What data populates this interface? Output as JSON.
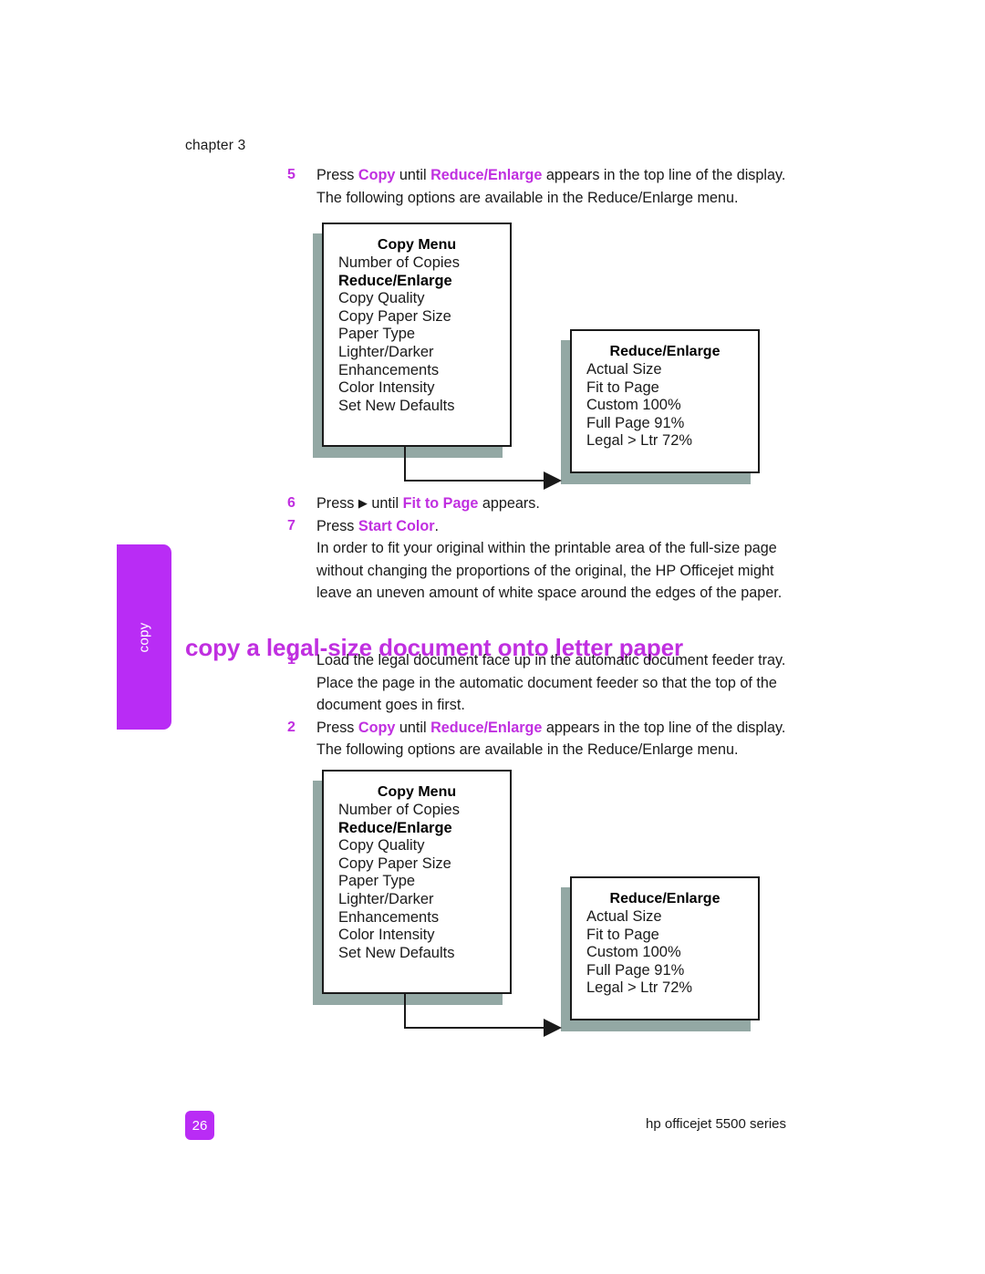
{
  "header": {
    "chapter": "chapter 3"
  },
  "side_tab": {
    "label": "copy"
  },
  "section_heading": "copy a legal-size document onto letter paper",
  "steps_top": [
    {
      "num": "5",
      "parts": [
        {
          "t": "Press ",
          "k": "n"
        },
        {
          "t": "Copy",
          "k": "ui"
        },
        {
          "t": " until ",
          "k": "n"
        },
        {
          "t": "Reduce/Enlarge",
          "k": "ui"
        },
        {
          "t": " appears in the top line of the display.",
          "k": "n"
        },
        {
          "t": "The following options are available in the Reduce/Enlarge menu.",
          "k": "br"
        }
      ]
    }
  ],
  "steps_mid": [
    {
      "num": "6",
      "parts": [
        {
          "t": "Press ",
          "k": "n"
        },
        {
          "t": "▶",
          "k": "tri"
        },
        {
          "t": " until ",
          "k": "n"
        },
        {
          "t": "Fit to Page",
          "k": "ui"
        },
        {
          "t": " appears.",
          "k": "n"
        }
      ]
    },
    {
      "num": "7",
      "parts": [
        {
          "t": "Press ",
          "k": "n"
        },
        {
          "t": "Start Color",
          "k": "ui"
        },
        {
          "t": ".",
          "k": "n"
        },
        {
          "t": "In order to fit your original within the printable area of the full-size page without changing the proportions of the original, the HP Officejet might leave an uneven amount of white space around the edges of the paper.",
          "k": "br"
        }
      ]
    }
  ],
  "steps_bottom": [
    {
      "num": "1",
      "parts": [
        {
          "t": "Load the legal document face up in the automatic document feeder tray. Place the page in the automatic document feeder so that the top of the document goes in first.",
          "k": "n"
        }
      ]
    },
    {
      "num": "2",
      "parts": [
        {
          "t": "Press ",
          "k": "n"
        },
        {
          "t": "Copy",
          "k": "ui"
        },
        {
          "t": " until ",
          "k": "n"
        },
        {
          "t": "Reduce/Enlarge",
          "k": "ui"
        },
        {
          "t": " appears in the top line of the display.",
          "k": "n"
        },
        {
          "t": "The following options are available in the Reduce/Enlarge menu.",
          "k": "br"
        }
      ]
    }
  ],
  "diagrams": [
    {
      "copy_menu": {
        "title": "Copy Menu",
        "items": [
          {
            "label": "Number of Copies",
            "highlight": false
          },
          {
            "label": "Reduce/Enlarge",
            "highlight": true
          },
          {
            "label": "Copy Quality",
            "highlight": false
          },
          {
            "label": "Copy Paper Size",
            "highlight": false
          },
          {
            "label": "Paper Type",
            "highlight": false
          },
          {
            "label": "Lighter/Darker",
            "highlight": false
          },
          {
            "label": "Enhancements",
            "highlight": false
          },
          {
            "label": "Color Intensity",
            "highlight": false
          },
          {
            "label": "Set New Defaults",
            "highlight": false
          }
        ]
      },
      "reduce_enlarge": {
        "title": "Reduce/Enlarge",
        "items": [
          {
            "label": "Actual Size",
            "highlight": false
          },
          {
            "label": "Fit to Page",
            "highlight": false
          },
          {
            "label": "Custom 100%",
            "highlight": false
          },
          {
            "label": "Full Page 91%",
            "highlight": false
          },
          {
            "label": "Legal > Ltr 72%",
            "highlight": false
          }
        ]
      }
    },
    {
      "copy_menu": {
        "title": "Copy Menu",
        "items": [
          {
            "label": "Number of Copies",
            "highlight": false
          },
          {
            "label": "Reduce/Enlarge",
            "highlight": true
          },
          {
            "label": "Copy Quality",
            "highlight": false
          },
          {
            "label": "Copy Paper Size",
            "highlight": false
          },
          {
            "label": "Paper Type",
            "highlight": false
          },
          {
            "label": "Lighter/Darker",
            "highlight": false
          },
          {
            "label": "Enhancements",
            "highlight": false
          },
          {
            "label": "Color Intensity",
            "highlight": false
          },
          {
            "label": "Set New Defaults",
            "highlight": false
          }
        ]
      },
      "reduce_enlarge": {
        "title": "Reduce/Enlarge",
        "items": [
          {
            "label": "Actual Size",
            "highlight": false
          },
          {
            "label": "Fit to Page",
            "highlight": false
          },
          {
            "label": "Custom 100%",
            "highlight": false
          },
          {
            "label": "Full Page 91%",
            "highlight": false
          },
          {
            "label": "Legal > Ltr 72%",
            "highlight": false
          }
        ]
      }
    }
  ],
  "footer": {
    "page_number": "26",
    "product": "hp officejet 5500 series"
  },
  "colors": {
    "accent_magenta": "#c02fe0",
    "tab_purple": "#b92cf5",
    "box_shadow": "#93a8a4",
    "ink": "#1a1a1a"
  }
}
